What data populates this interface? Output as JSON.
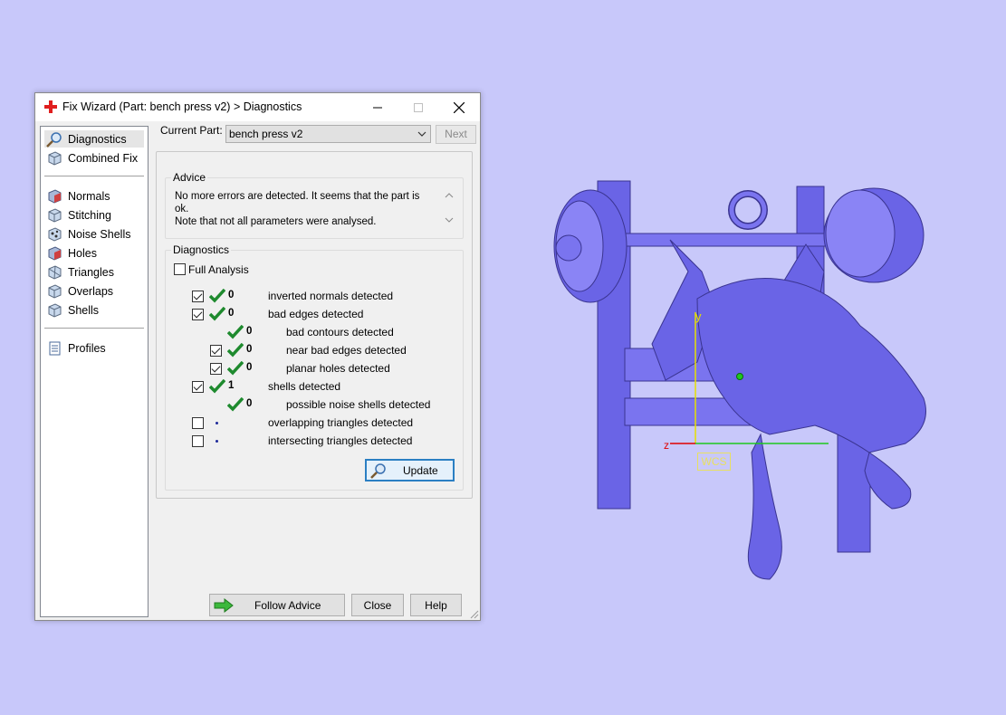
{
  "window": {
    "title": "Fix Wizard (Part: bench press v2) > Diagnostics",
    "icons": {
      "app": "red-cross-icon",
      "minimize": "minimize-icon",
      "maximize": "maximize-icon",
      "close": "close-icon"
    }
  },
  "sidebar": {
    "items": [
      {
        "label": "Diagnostics",
        "icon": "magnifier-icon",
        "selected": true
      },
      {
        "label": "Combined Fix",
        "icon": "cube-icon"
      },
      {
        "label": "Normals",
        "icon": "normals-icon"
      },
      {
        "label": "Stitching",
        "icon": "stitching-icon"
      },
      {
        "label": "Noise Shells",
        "icon": "noise-shells-icon"
      },
      {
        "label": "Holes",
        "icon": "holes-icon"
      },
      {
        "label": "Triangles",
        "icon": "triangles-icon"
      },
      {
        "label": "Overlaps",
        "icon": "overlaps-icon"
      },
      {
        "label": "Shells",
        "icon": "shells-icon"
      },
      {
        "label": "Profiles",
        "icon": "document-icon"
      }
    ]
  },
  "top": {
    "current_part_label": "Current Part:",
    "current_part_value": "bench press v2",
    "next_label": "Next"
  },
  "advice": {
    "title": "Advice",
    "text": "No more errors are detected. It seems that the part is ok.\nNote that not all parameters were analysed."
  },
  "diagnostics": {
    "title": "Diagnostics",
    "full_analysis_label": "Full Analysis",
    "full_analysis_checked": false,
    "rows": [
      {
        "count": "0",
        "label": "inverted normals detected",
        "checked": true,
        "status": "ok"
      },
      {
        "count": "0",
        "label": "bad edges detected",
        "checked": true,
        "status": "ok"
      },
      {
        "count": "0",
        "label": "bad contours detected",
        "checked": null,
        "status": "ok"
      },
      {
        "count": "0",
        "label": "near bad edges detected",
        "checked": true,
        "status": "ok"
      },
      {
        "count": "0",
        "label": "planar holes detected",
        "checked": true,
        "status": "ok"
      },
      {
        "count": "1",
        "label": "shells detected",
        "checked": true,
        "status": "ok"
      },
      {
        "count": "0",
        "label": "possible noise shells detected",
        "checked": null,
        "status": "ok"
      },
      {
        "count": "",
        "label": "overlapping triangles detected",
        "checked": false,
        "status": "not-analysed"
      },
      {
        "count": "",
        "label": "intersecting triangles detected",
        "checked": false,
        "status": "not-analysed"
      }
    ],
    "update_label": "Update"
  },
  "footer": {
    "follow_advice_label": "Follow Advice",
    "close_label": "Close",
    "help_label": "Help"
  },
  "viewport": {
    "wcs_label": "WCS",
    "axis_y": "y",
    "axis_z": "z",
    "model_color": "#6a64e6",
    "background": "#c8c8fa"
  }
}
